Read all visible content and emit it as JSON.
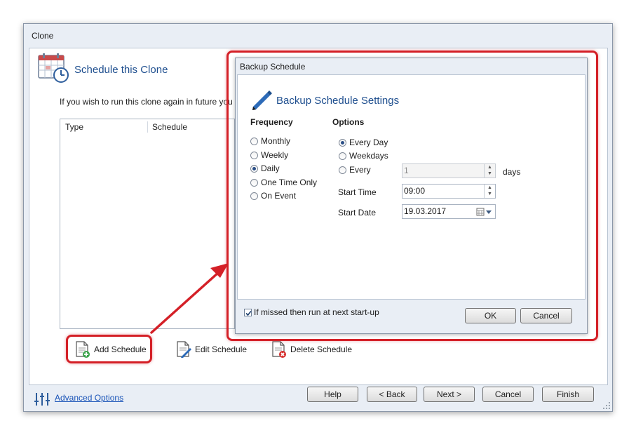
{
  "window": {
    "title": "Clone",
    "header_title": "Schedule this Clone",
    "info_text": "If you wish to run this clone again in future you ca",
    "list_columns": [
      "Type",
      "Schedule"
    ],
    "actions": {
      "add": "Add Schedule",
      "edit": "Edit Schedule",
      "delete": "Delete Schedule"
    },
    "advanced_options": "Advanced Options",
    "buttons": {
      "help": "Help",
      "back": "< Back",
      "next": "Next >",
      "cancel": "Cancel",
      "finish": "Finish"
    }
  },
  "dialog": {
    "title": "Backup Schedule",
    "header_title": "Backup Schedule Settings",
    "frequency_label": "Frequency",
    "frequency_options": [
      "Monthly",
      "Weekly",
      "Daily",
      "One Time Only",
      "On Event"
    ],
    "frequency_selected": "Daily",
    "options_label": "Options",
    "options": [
      "Every Day",
      "Weekdays",
      "Every"
    ],
    "options_selected": "Every Day",
    "every_value": "1",
    "days_label": "days",
    "start_time_label": "Start Time",
    "start_time_value": "09:00",
    "start_date_label": "Start Date",
    "start_date_value": "19.03.2017",
    "missed_label": "If missed then run at next start-up",
    "missed_checked": true,
    "ok": "OK",
    "cancel": "Cancel"
  },
  "colors": {
    "highlight": "#d42027",
    "title_blue": "#1f4f8f",
    "link": "#1a54b8"
  }
}
